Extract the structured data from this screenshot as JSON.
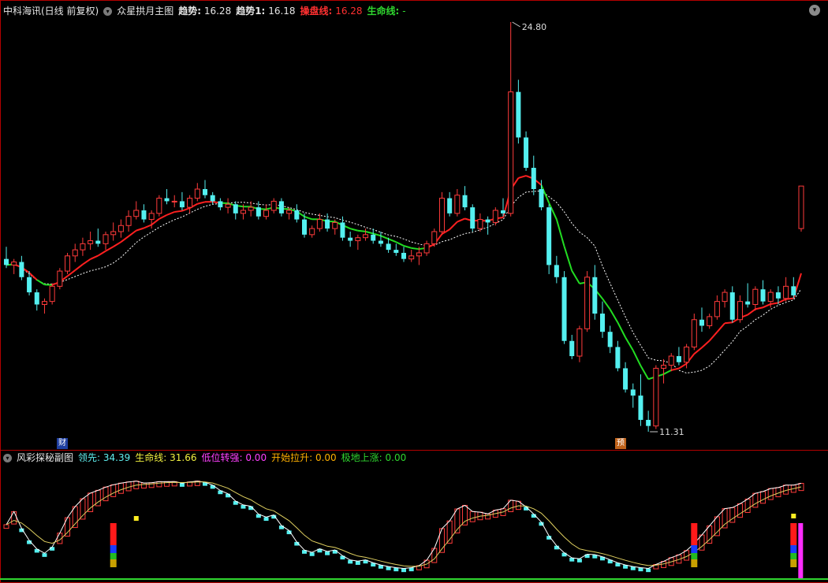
{
  "main_header": {
    "stock": "中科海讯(日线 前复权)",
    "indicator_name": "众星拱月主图",
    "trend_label": "趋势:",
    "trend_value": "16.28",
    "trend1_label": "趋势1:",
    "trend1_value": "16.18",
    "ops_label": "操盘线:",
    "ops_value": "16.28",
    "life_label": "生命线:",
    "life_value": "-"
  },
  "sub_header": {
    "indicator_name": "风彩探秘副图",
    "lead_label": "领先:",
    "lead_value": "34.39",
    "life_label": "生命线:",
    "life_value": "31.66",
    "low_label": "低位转强:",
    "low_value": "0.00",
    "start_label": "开始拉升:",
    "start_value": "0.00",
    "bottom_label": "极地上涨:",
    "bottom_value": "0.00"
  },
  "markers": {
    "cai": "财",
    "yu": "预"
  },
  "colors": {
    "up": "#ff3b3b",
    "down": "#54f0f0",
    "ops_up": "#ff2020",
    "ops_down": "#22dd22",
    "dotted": "#ffffff",
    "border": "#b30000"
  },
  "chart_data": {
    "type": "candlestick",
    "annotations": {
      "high": "24.80",
      "low": "11.31"
    },
    "candles": [
      [
        17.0,
        17.4,
        16.7,
        16.8
      ],
      [
        16.8,
        17.0,
        16.5,
        16.9
      ],
      [
        16.9,
        17.1,
        16.3,
        16.4
      ],
      [
        16.4,
        16.6,
        15.8,
        15.9
      ],
      [
        15.9,
        16.0,
        15.3,
        15.5
      ],
      [
        15.5,
        15.7,
        15.2,
        15.6
      ],
      [
        15.6,
        16.2,
        15.5,
        16.1
      ],
      [
        16.1,
        16.7,
        16.0,
        16.6
      ],
      [
        16.6,
        17.2,
        16.5,
        17.1
      ],
      [
        17.1,
        17.5,
        16.9,
        17.3
      ],
      [
        17.3,
        17.7,
        17.1,
        17.5
      ],
      [
        17.5,
        17.9,
        17.3,
        17.6
      ],
      [
        17.6,
        18.0,
        17.4,
        17.5
      ],
      [
        17.5,
        17.9,
        17.3,
        17.8
      ],
      [
        17.8,
        18.2,
        17.6,
        17.9
      ],
      [
        17.9,
        18.3,
        17.7,
        18.1
      ],
      [
        18.1,
        18.6,
        17.9,
        18.4
      ],
      [
        18.4,
        18.9,
        18.3,
        18.6
      ],
      [
        18.6,
        18.8,
        18.2,
        18.3
      ],
      [
        18.3,
        18.6,
        18.0,
        18.5
      ],
      [
        18.5,
        19.1,
        18.4,
        19.0
      ],
      [
        19.0,
        19.3,
        18.8,
        18.9
      ],
      [
        18.9,
        19.1,
        18.7,
        18.9
      ],
      [
        18.9,
        19.2,
        18.6,
        18.7
      ],
      [
        18.7,
        19.1,
        18.5,
        19.0
      ],
      [
        19.0,
        19.5,
        18.9,
        19.3
      ],
      [
        19.3,
        19.6,
        19.0,
        19.1
      ],
      [
        19.1,
        19.2,
        18.8,
        18.9
      ],
      [
        18.9,
        19.0,
        18.6,
        18.7
      ],
      [
        18.7,
        19.0,
        18.5,
        18.8
      ],
      [
        18.8,
        18.9,
        18.3,
        18.5
      ],
      [
        18.5,
        18.8,
        18.3,
        18.6
      ],
      [
        18.6,
        18.9,
        18.4,
        18.7
      ],
      [
        18.7,
        18.9,
        18.3,
        18.4
      ],
      [
        18.4,
        18.8,
        18.3,
        18.6
      ],
      [
        18.6,
        19.0,
        18.5,
        18.9
      ],
      [
        18.9,
        19.0,
        18.4,
        18.5
      ],
      [
        18.5,
        18.7,
        18.3,
        18.6
      ],
      [
        18.6,
        18.8,
        18.2,
        18.3
      ],
      [
        18.3,
        18.5,
        17.7,
        17.8
      ],
      [
        17.8,
        18.1,
        17.7,
        18.0
      ],
      [
        18.0,
        18.5,
        17.9,
        18.3
      ],
      [
        18.3,
        18.5,
        17.9,
        18.0
      ],
      [
        18.0,
        18.3,
        17.8,
        18.2
      ],
      [
        18.2,
        18.4,
        17.6,
        17.7
      ],
      [
        17.7,
        17.9,
        17.4,
        17.6
      ],
      [
        17.6,
        17.8,
        17.3,
        17.7
      ],
      [
        17.7,
        18.0,
        17.6,
        17.8
      ],
      [
        17.8,
        18.0,
        17.5,
        17.6
      ],
      [
        17.6,
        17.9,
        17.4,
        17.5
      ],
      [
        17.5,
        17.7,
        17.2,
        17.3
      ],
      [
        17.3,
        17.5,
        17.1,
        17.2
      ],
      [
        17.2,
        17.4,
        16.9,
        17.0
      ],
      [
        17.0,
        17.3,
        16.9,
        17.1
      ],
      [
        17.1,
        17.4,
        16.8,
        17.2
      ],
      [
        17.2,
        17.6,
        17.1,
        17.5
      ],
      [
        17.5,
        18.0,
        17.4,
        17.9
      ],
      [
        17.9,
        19.2,
        17.8,
        19.0
      ],
      [
        19.0,
        19.2,
        18.4,
        18.5
      ],
      [
        18.5,
        19.3,
        18.4,
        19.1
      ],
      [
        19.1,
        19.4,
        18.6,
        18.7
      ],
      [
        18.7,
        18.8,
        17.9,
        18.0
      ],
      [
        18.0,
        18.5,
        17.9,
        18.3
      ],
      [
        18.3,
        18.4,
        17.8,
        18.2
      ],
      [
        18.2,
        18.7,
        18.1,
        18.6
      ],
      [
        18.6,
        19.0,
        18.4,
        18.5
      ],
      [
        18.5,
        24.8,
        18.4,
        22.5
      ],
      [
        22.5,
        22.9,
        20.8,
        21.0
      ],
      [
        21.0,
        21.2,
        19.9,
        20.0
      ],
      [
        20.0,
        20.4,
        19.1,
        19.3
      ],
      [
        19.3,
        19.6,
        18.6,
        18.7
      ],
      [
        18.7,
        18.8,
        16.5,
        16.8
      ],
      [
        16.8,
        17.1,
        16.2,
        16.4
      ],
      [
        16.4,
        16.6,
        14.2,
        14.3
      ],
      [
        14.3,
        14.5,
        13.7,
        13.8
      ],
      [
        13.8,
        14.8,
        13.6,
        14.7
      ],
      [
        14.7,
        16.6,
        14.6,
        16.4
      ],
      [
        16.4,
        16.8,
        15.0,
        15.2
      ],
      [
        15.2,
        15.6,
        14.4,
        14.6
      ],
      [
        14.6,
        14.8,
        13.9,
        14.1
      ],
      [
        14.1,
        14.3,
        13.3,
        13.4
      ],
      [
        13.4,
        13.6,
        12.6,
        12.7
      ],
      [
        12.7,
        12.9,
        12.1,
        12.5
      ],
      [
        12.5,
        13.2,
        11.5,
        11.7
      ],
      [
        11.7,
        12.0,
        11.31,
        11.5
      ],
      [
        11.5,
        13.5,
        11.4,
        13.4
      ],
      [
        13.4,
        13.7,
        12.9,
        13.5
      ],
      [
        13.5,
        13.9,
        13.3,
        13.8
      ],
      [
        13.8,
        14.1,
        13.5,
        13.6
      ],
      [
        13.6,
        14.2,
        13.4,
        14.1
      ],
      [
        14.1,
        15.2,
        14.0,
        15.0
      ],
      [
        15.0,
        15.4,
        14.6,
        14.8
      ],
      [
        14.8,
        15.2,
        14.7,
        15.1
      ],
      [
        15.1,
        15.8,
        15.0,
        15.6
      ],
      [
        15.6,
        16.0,
        15.4,
        15.9
      ],
      [
        15.9,
        16.1,
        14.9,
        15.0
      ],
      [
        15.0,
        15.8,
        14.9,
        15.6
      ],
      [
        15.6,
        16.2,
        15.4,
        15.5
      ],
      [
        15.5,
        16.1,
        15.3,
        16.0
      ],
      [
        16.0,
        16.3,
        15.5,
        15.6
      ],
      [
        15.6,
        16.0,
        15.4,
        15.9
      ],
      [
        15.9,
        16.1,
        15.5,
        15.7
      ],
      [
        15.7,
        16.4,
        15.6,
        16.1
      ],
      [
        16.1,
        16.4,
        15.7,
        15.8
      ],
      [
        18.0,
        18.3,
        17.9,
        19.4
      ]
    ]
  }
}
